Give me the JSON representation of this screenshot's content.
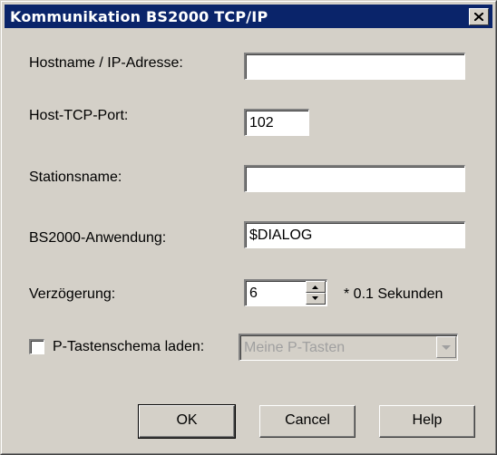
{
  "window": {
    "title": "Kommunikation BS2000 TCP/IP",
    "close_icon": "close-x-icon"
  },
  "form": {
    "hostname": {
      "label": "Hostname / IP-Adresse:",
      "value": ""
    },
    "port": {
      "label": "Host-TCP-Port:",
      "value": "102"
    },
    "station": {
      "label": "Stationsname:",
      "value": ""
    },
    "application": {
      "label": "BS2000-Anwendung:",
      "value": "$DIALOG"
    },
    "delay": {
      "label": "Verzögerung:",
      "value": "6",
      "unit": "* 0.1 Sekunden"
    },
    "pkeys": {
      "label": "P-Tastenschema laden:",
      "checked": false,
      "selected": "Meine P-Tasten",
      "disabled": true
    }
  },
  "buttons": {
    "ok": "OK",
    "cancel": "Cancel",
    "help": "Help"
  },
  "colors": {
    "titlebar": "#0a246a",
    "dialog_bg": "#d4d0c8"
  }
}
